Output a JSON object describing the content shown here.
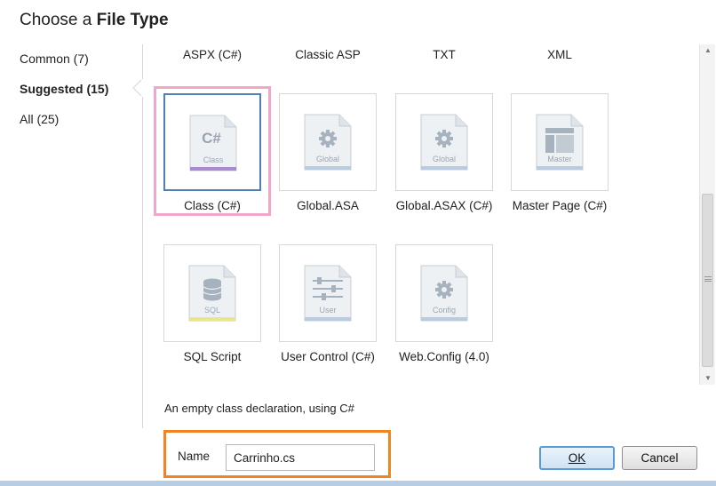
{
  "dialog": {
    "title_prefix": "Choose a ",
    "title_bold": "File Type"
  },
  "categories": [
    {
      "label": "Common (7)",
      "selected": false
    },
    {
      "label": "Suggested (15)",
      "selected": true
    },
    {
      "label": "All (25)",
      "selected": false
    }
  ],
  "top_row_labels": [
    "ASPX (C#)",
    "Classic ASP",
    "TXT",
    "XML"
  ],
  "tiles": [
    {
      "caption": "Class (C#)",
      "icon_label": "Class",
      "icon_glyph": "C#",
      "icon": "csharp-class-icon",
      "band_color": "#a98ad0",
      "selected": true
    },
    {
      "caption": "Global.ASA",
      "icon_label": "Global",
      "icon_glyph": "gear",
      "icon": "gear-icon",
      "band_color": "#b9ccdf",
      "selected": false
    },
    {
      "caption": "Global.ASAX (C#)",
      "icon_label": "Global",
      "icon_glyph": "gear",
      "icon": "gear-icon",
      "band_color": "#b9ccdf",
      "selected": false
    },
    {
      "caption": "Master Page (C#)",
      "icon_label": "Master",
      "icon_glyph": "layout",
      "icon": "master-page-icon",
      "band_color": "#b9ccdf",
      "selected": false
    },
    {
      "caption": "SQL Script",
      "icon_label": "SQL",
      "icon_glyph": "database",
      "icon": "database-icon",
      "band_color": "#e8e58c",
      "selected": false
    },
    {
      "caption": "User Control (C#)",
      "icon_label": "User",
      "icon_glyph": "sliders",
      "icon": "user-control-icon",
      "band_color": "#b9ccdf",
      "selected": false
    },
    {
      "caption": "Web.Config (4.0)",
      "icon_label": "Config",
      "icon_glyph": "gear",
      "icon": "gear-icon",
      "band_color": "#b9ccdf",
      "selected": false
    }
  ],
  "description": "An empty class declaration, using C#",
  "name_field": {
    "label": "Name",
    "value": "Carrinho.cs"
  },
  "buttons": {
    "ok_label": "OK",
    "cancel_label": "Cancel"
  },
  "colors": {
    "selection_highlight": "#f2a6c8",
    "name_highlight": "#f08420",
    "selected_tile_border": "#4f7fb7",
    "ok_button_border": "#5a9ad6"
  }
}
